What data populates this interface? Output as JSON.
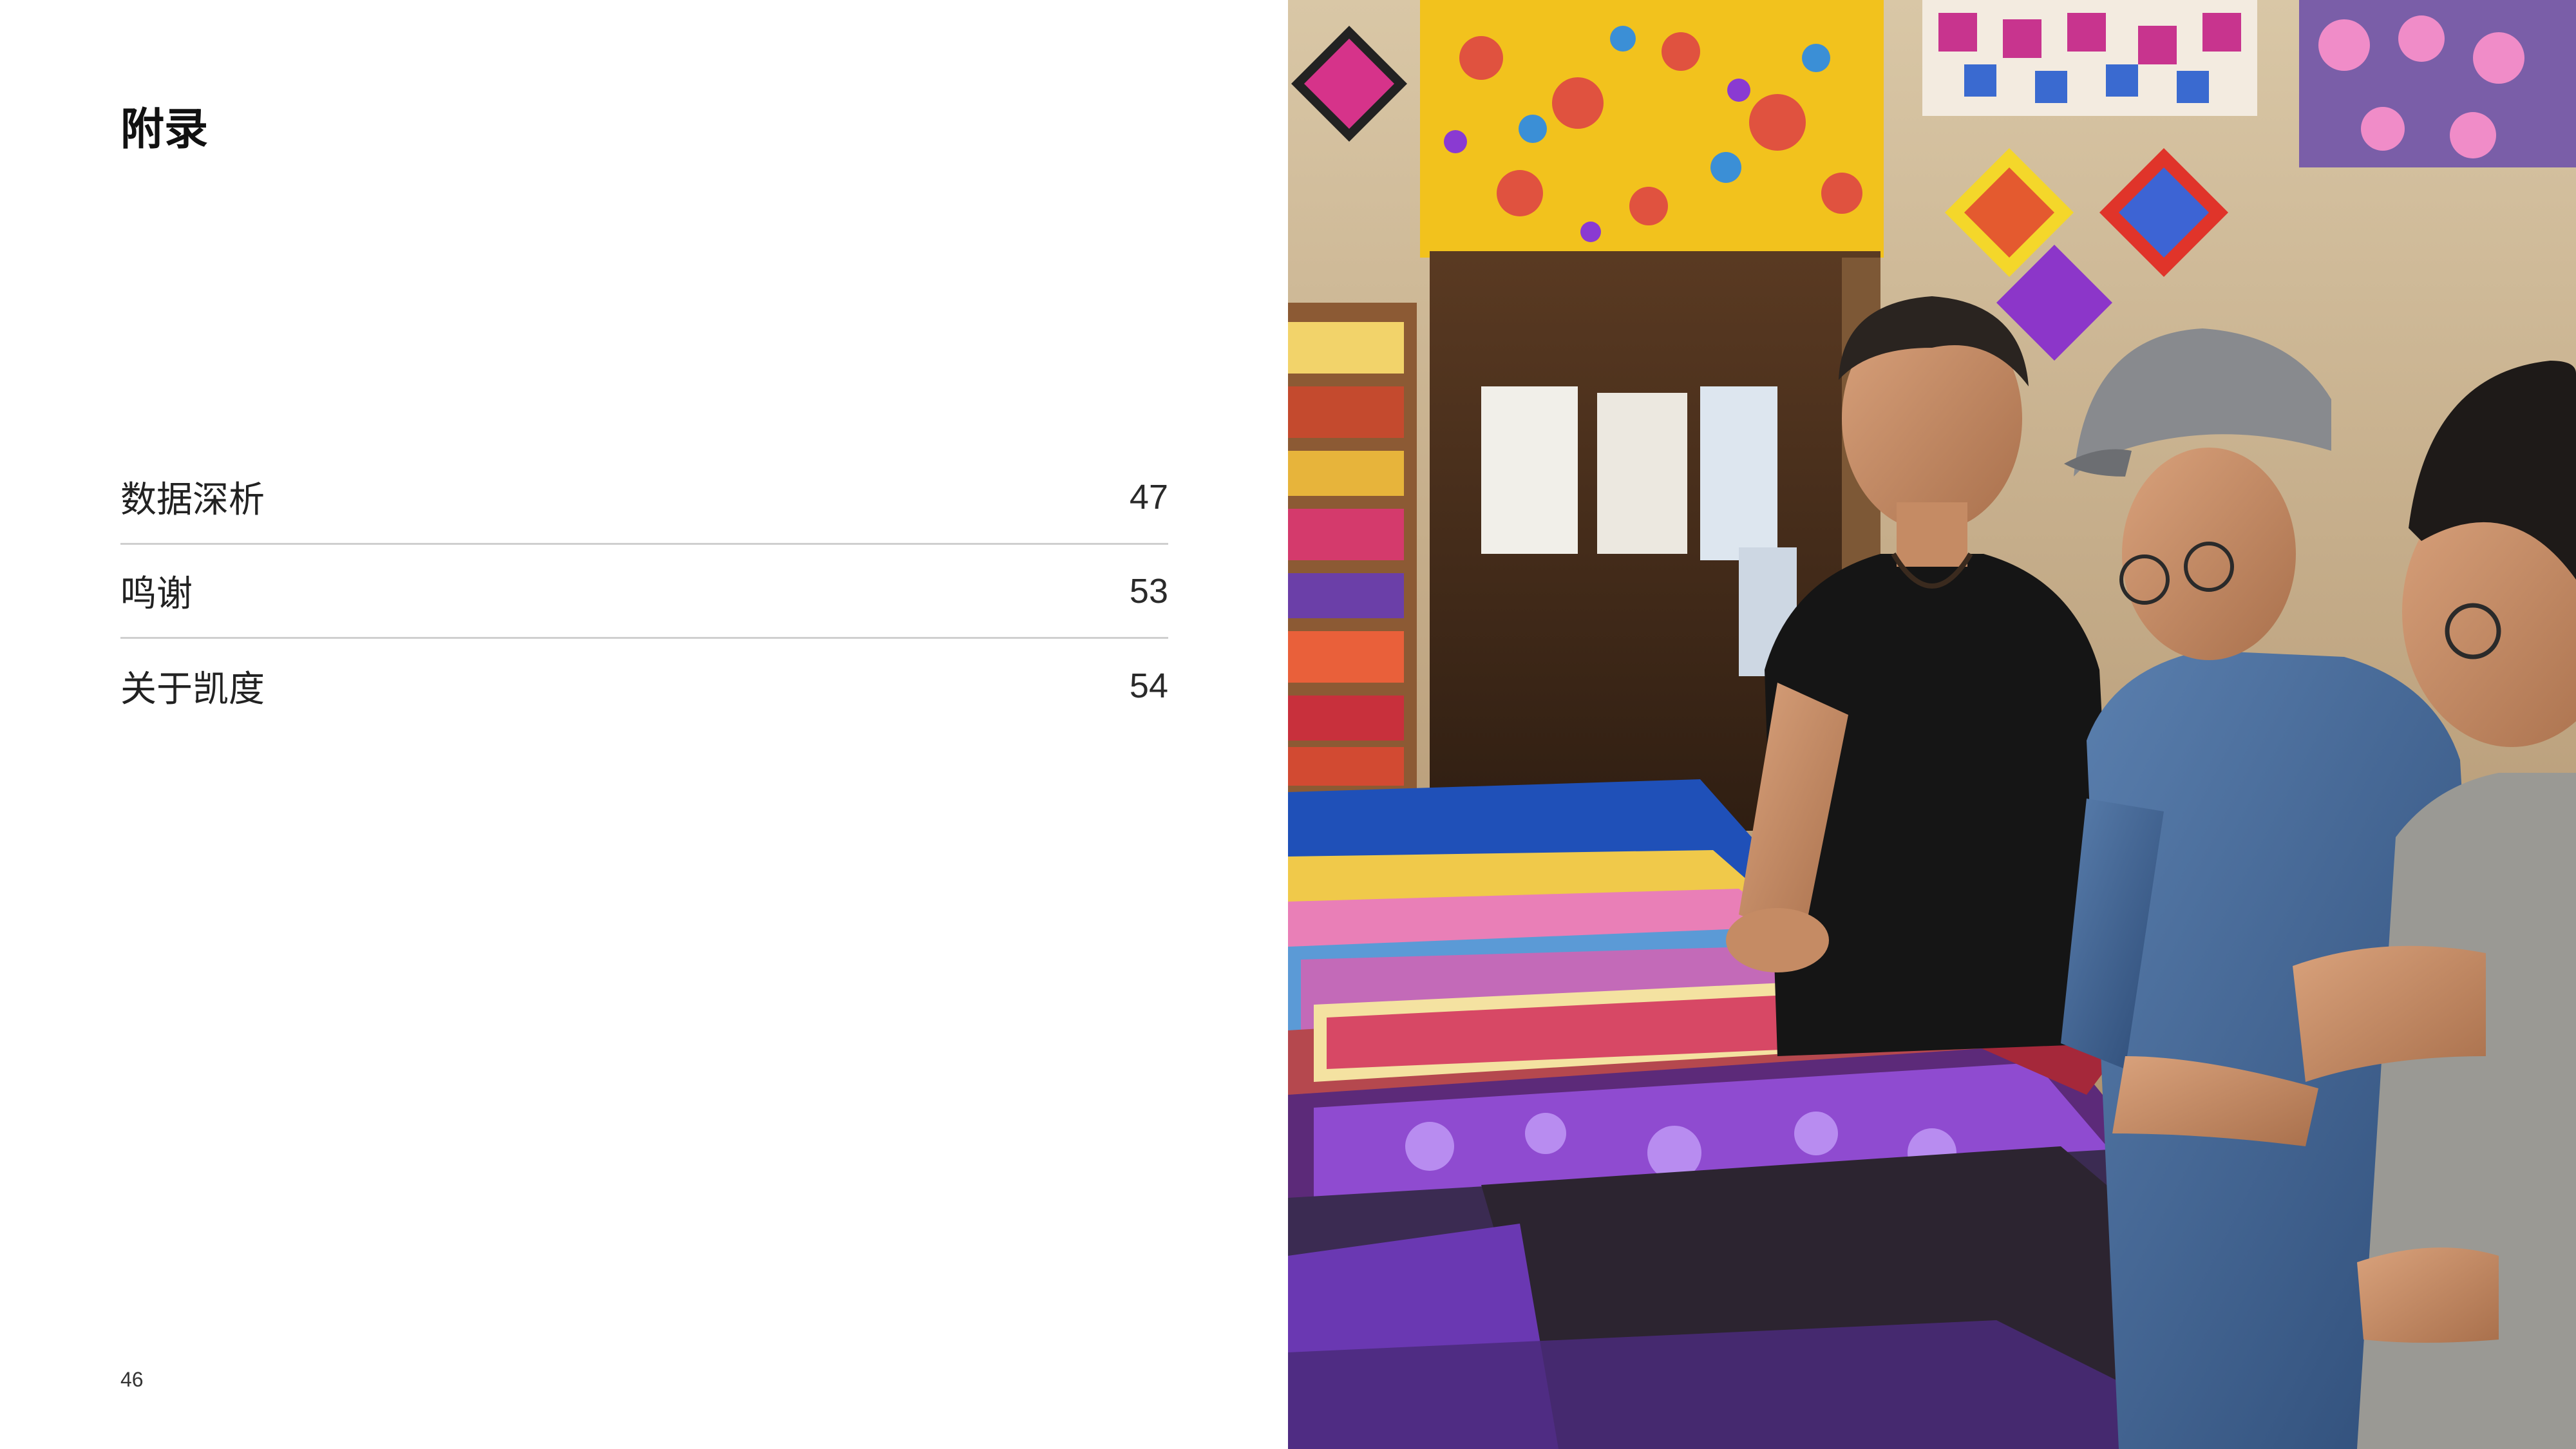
{
  "page": {
    "title": "附录",
    "page_number": "46"
  },
  "toc": {
    "items": [
      {
        "label": "数据深析",
        "page": "47"
      },
      {
        "label": "鸣谢",
        "page": "53"
      },
      {
        "label": "关于凯度",
        "page": "54"
      }
    ]
  },
  "photo": {
    "subject": "three-men-browsing-textiles-photo"
  },
  "colors": {
    "divider": "#cfcfcf",
    "text": "#1a1a1a",
    "background": "#ffffff"
  }
}
